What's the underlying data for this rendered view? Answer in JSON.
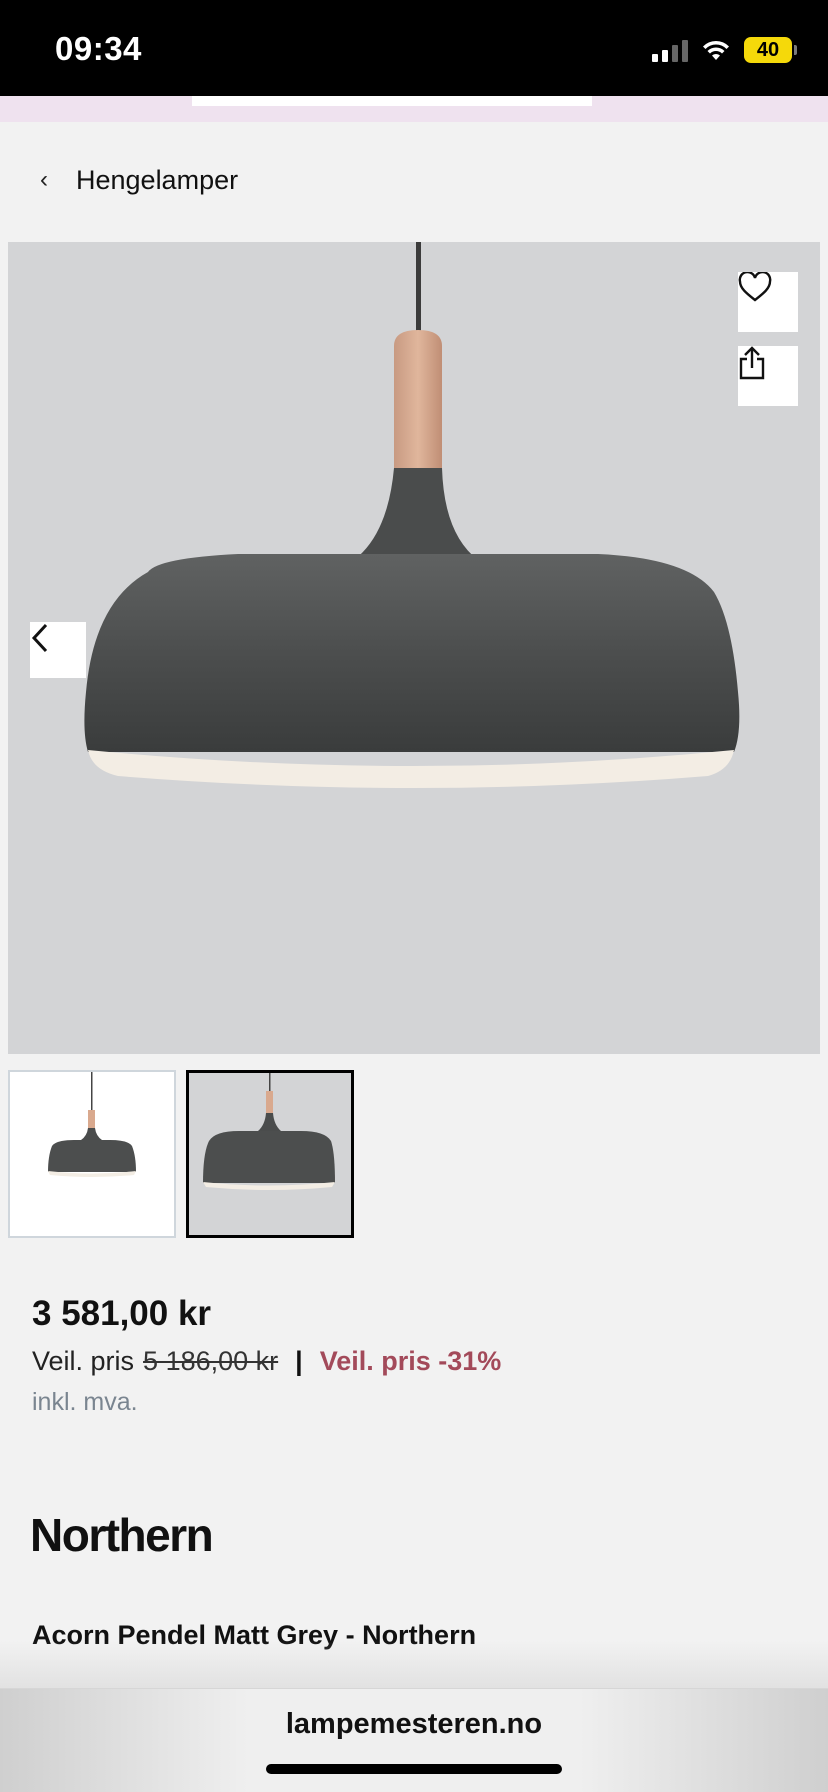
{
  "status_bar": {
    "time": "09:34",
    "battery": "40"
  },
  "breadcrumb": {
    "label": "Hengelamper"
  },
  "gallery": {
    "thumbnails": [
      {
        "selected": false
      },
      {
        "selected": true
      }
    ]
  },
  "price": {
    "current": "3 581,00 kr",
    "veil_label": "Veil. pris",
    "veil_old": "5 186,00 kr",
    "separator": "|",
    "discount": "Veil. pris -31%",
    "vat_note": "inkl. mva."
  },
  "brand": {
    "name": "Northern"
  },
  "product": {
    "title": "Acorn Pendel Matt Grey - Northern"
  },
  "browser": {
    "url": "lampemesteren.no"
  },
  "colors": {
    "discount": "#a34a5a",
    "image_bg": "#d3d4d6",
    "status_bar_bg": "#000000"
  }
}
